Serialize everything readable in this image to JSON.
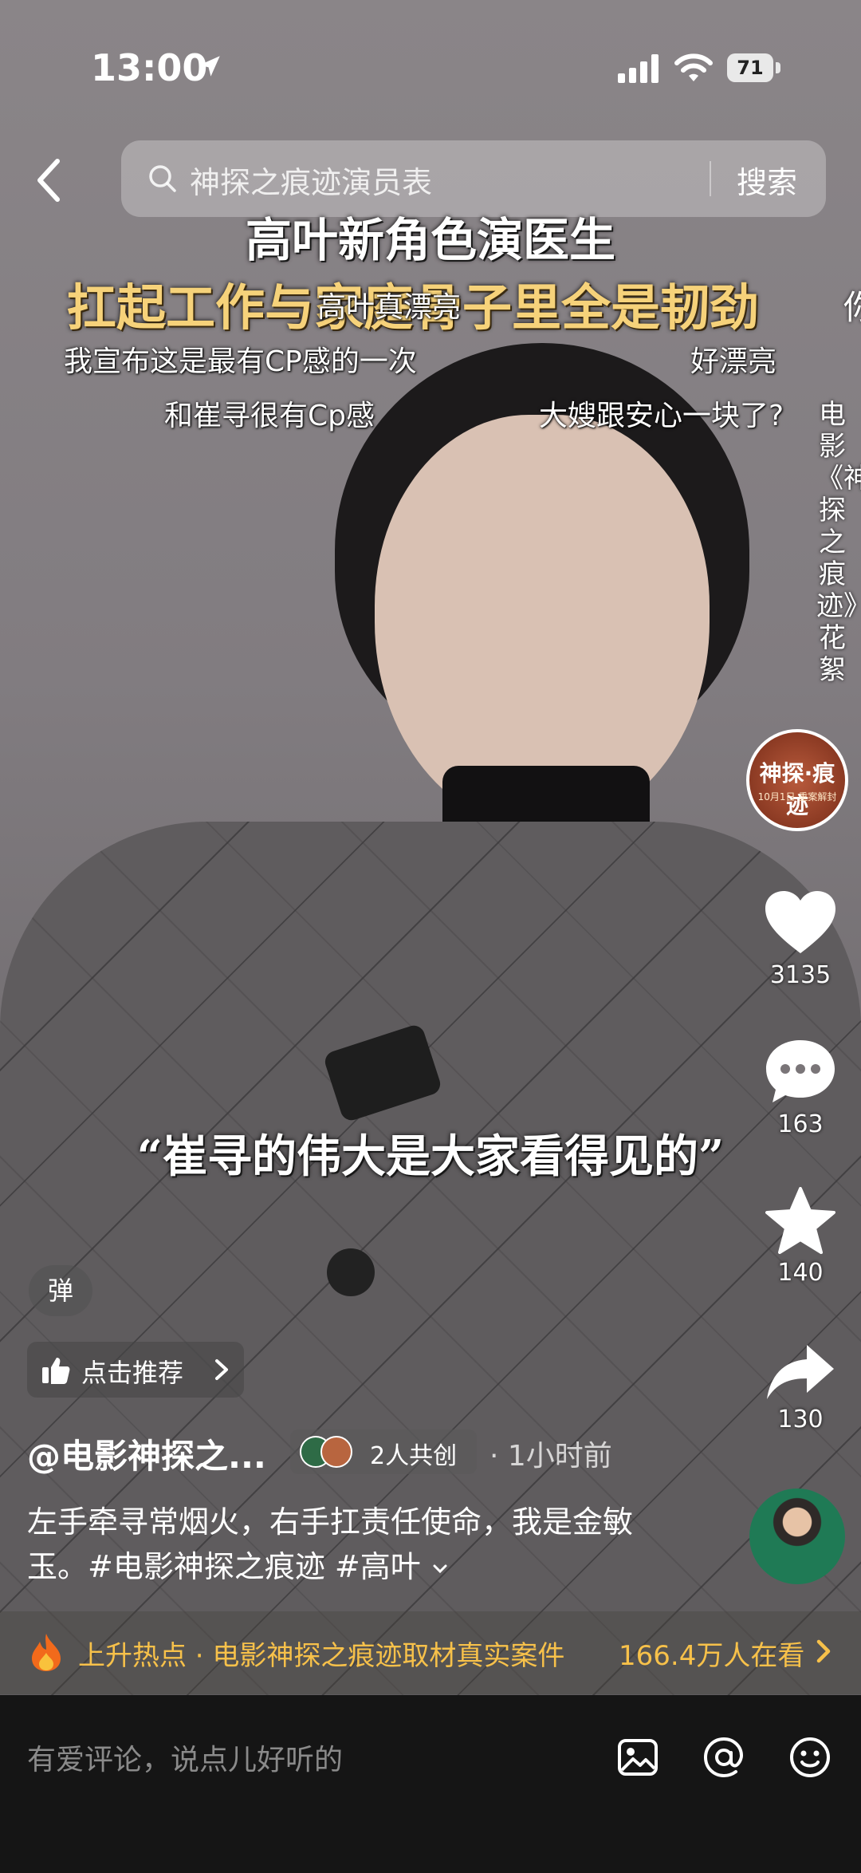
{
  "status_bar": {
    "time": "13:00",
    "battery": "71"
  },
  "search": {
    "query": "神探之痕迹演员表",
    "button": "搜索"
  },
  "overlay_titles": {
    "line1": "高叶新角色演医生",
    "line2": "扛起工作与家庭骨子里全是韧劲"
  },
  "danmaku": [
    "高叶真漂亮",
    "我宣布这是最有CP感的一次",
    "好漂亮",
    "和崔寻很有Cp感",
    "大嫂跟安心一块了?"
  ],
  "edge_char": "你",
  "side_caption": "电影《神探之痕迹》花絮",
  "subtitle": "“崔寻的伟大是大家看得见的”",
  "poster_avatar": {
    "line1": "神探·痕迹",
    "line2": "10月1日 重案解封"
  },
  "actions": {
    "likes": "3135",
    "comments": "163",
    "favorites": "140",
    "shares": "130"
  },
  "danmaku_button": "弹",
  "recommend": {
    "label": "点击推荐"
  },
  "author": {
    "name": "@电影神探之...",
    "co_create": "2人共创",
    "time": "· 1小时前"
  },
  "description": {
    "text": "左手牵寻常烟火，右手扛责任使命，我是金敏玉。#电影神探之痕迹 #高叶"
  },
  "hot": {
    "text": "上升热点 · 电影神探之痕迹取材真实案件",
    "count": "166.4万人在看"
  },
  "comment_bar": {
    "placeholder": "有爱评论，说点儿好听的"
  },
  "colors": {
    "hot": "#f7c14a",
    "title_gold": "#f6d27a",
    "comment_bg": "#151515"
  }
}
